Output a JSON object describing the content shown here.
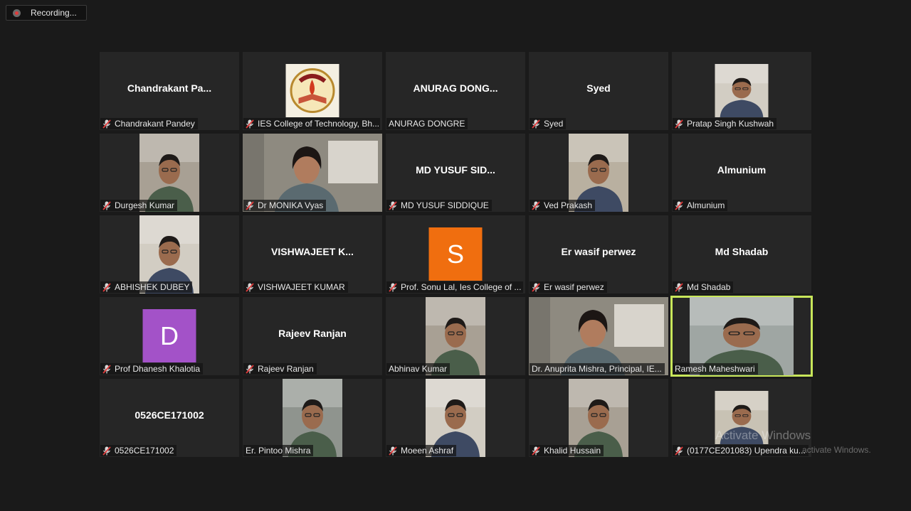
{
  "recording": {
    "label": "Recording..."
  },
  "participants": [
    {
      "big": "Chandrakant  Pa...",
      "label": "Chandrakant Pandey",
      "muted": true,
      "kind": "name"
    },
    {
      "big": "",
      "label": "IES College of Technology, Bh...",
      "muted": true,
      "kind": "logo"
    },
    {
      "big": "ANURAG DONG...",
      "label": "ANURAG DONGRE",
      "muted": false,
      "kind": "name"
    },
    {
      "big": "Syed",
      "label": "Syed",
      "muted": true,
      "kind": "name"
    },
    {
      "big": "",
      "label": "Pratap Singh Kushwah",
      "muted": true,
      "kind": "small-photo"
    },
    {
      "big": "",
      "label": "Durgesh Kumar",
      "muted": true,
      "kind": "photo"
    },
    {
      "big": "",
      "label": "Dr MONIKA Vyas",
      "muted": true,
      "kind": "photo-wide"
    },
    {
      "big": "MD YUSUF SID...",
      "label": "MD YUSUF SIDDIQUE",
      "muted": true,
      "kind": "name"
    },
    {
      "big": "",
      "label": "Ved Prakash",
      "muted": true,
      "kind": "photo"
    },
    {
      "big": "Almunium",
      "label": "Almunium",
      "muted": true,
      "kind": "name"
    },
    {
      "big": "",
      "label": "ABHISHEK DUBEY",
      "muted": true,
      "kind": "photo"
    },
    {
      "big": "VISHWAJEET  K...",
      "label": "VISHWAJEET KUMAR",
      "muted": true,
      "kind": "name"
    },
    {
      "big": "S",
      "label": "Prof. Sonu Lal, Ies College of ...",
      "muted": true,
      "kind": "avatar",
      "color": "#f06e0f"
    },
    {
      "big": "Er wasif perwez",
      "label": "Er wasif perwez",
      "muted": true,
      "kind": "name"
    },
    {
      "big": "Md Shadab",
      "label": "Md Shadab",
      "muted": true,
      "kind": "name"
    },
    {
      "big": "D",
      "label": "Prof Dhanesh Khalotia",
      "muted": true,
      "kind": "avatar",
      "color": "#a352c8"
    },
    {
      "big": "Rajeev Ranjan",
      "label": "Rajeev Ranjan",
      "muted": true,
      "kind": "name"
    },
    {
      "big": "",
      "label": "Abhinav Kumar",
      "muted": false,
      "kind": "photo"
    },
    {
      "big": "",
      "label": "Dr. Anuprita Mishra, Principal, IE...",
      "muted": false,
      "kind": "photo-wide"
    },
    {
      "big": "",
      "label": "Ramesh Maheshwari",
      "muted": false,
      "kind": "photo",
      "active": true
    },
    {
      "big": "0526CE171002",
      "label": "0526CE171002",
      "muted": true,
      "kind": "name"
    },
    {
      "big": "",
      "label": "Er. Pintoo Mishra",
      "muted": false,
      "kind": "photo"
    },
    {
      "big": "",
      "label": "Moeen Ashraf",
      "muted": true,
      "kind": "photo"
    },
    {
      "big": "",
      "label": "Khalid Hussain",
      "muted": true,
      "kind": "photo"
    },
    {
      "big": "",
      "label": "(0177CE201083) Upendra ku...",
      "muted": true,
      "kind": "small-photo"
    }
  ],
  "watermark": {
    "line1": "Activate Windows",
    "line2": "activate Windows."
  },
  "colors": {
    "active_border": "#c8e65a",
    "muted_mic": "#e03b3b"
  }
}
